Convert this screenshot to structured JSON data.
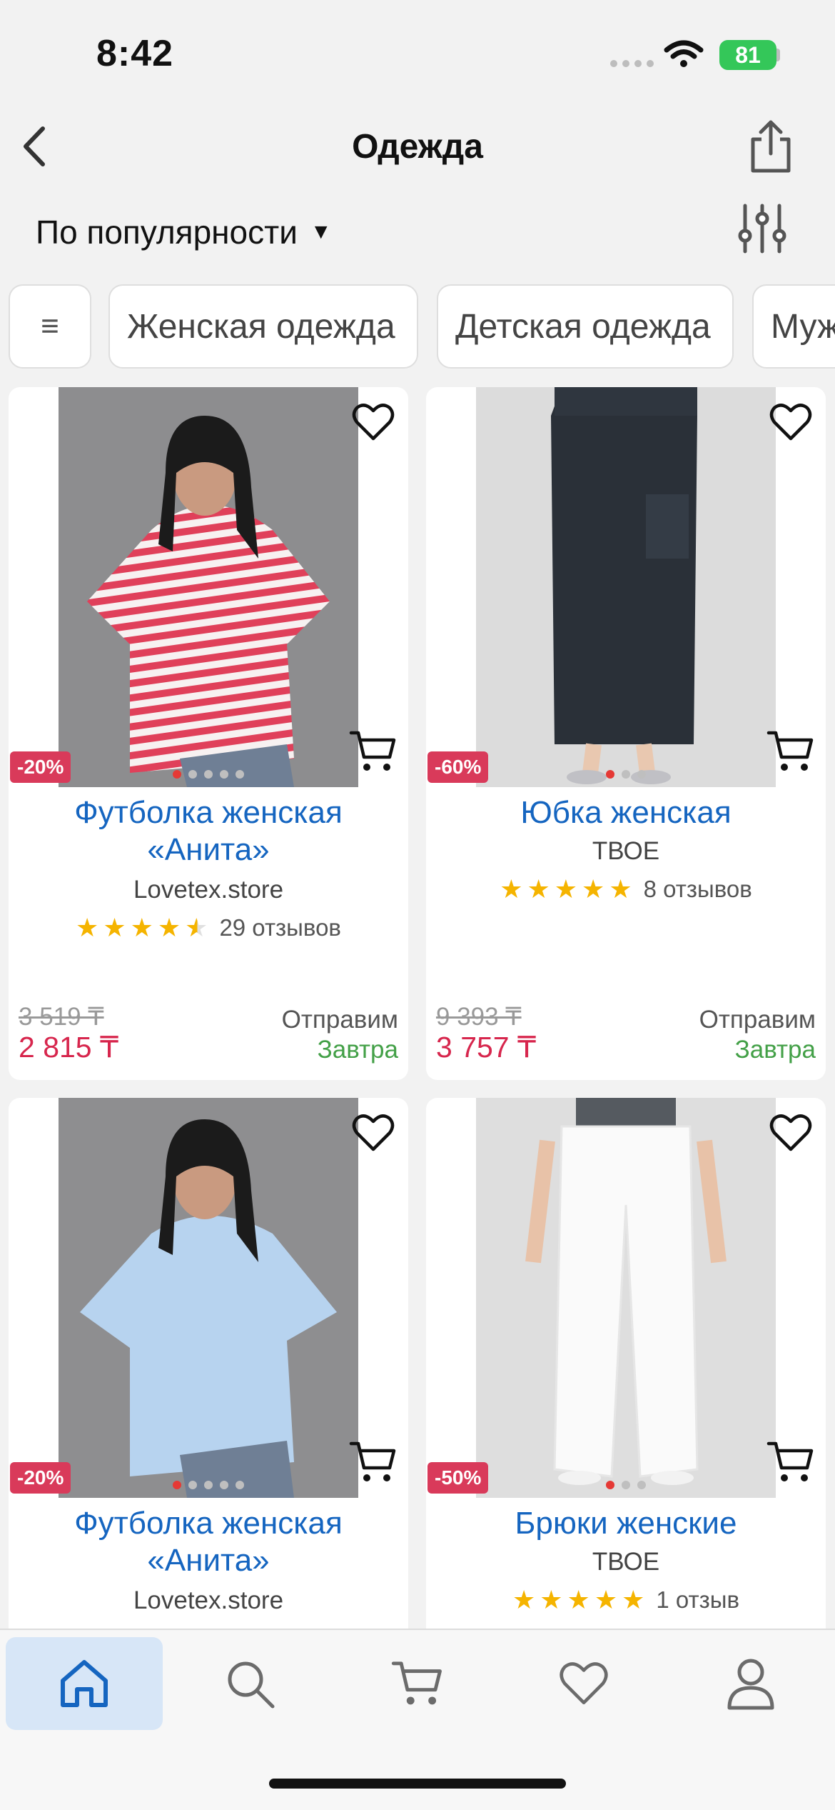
{
  "status_bar": {
    "time": "8:42",
    "battery": "81"
  },
  "header": {
    "title": "Одежда"
  },
  "sort": {
    "label": "По популярности",
    "caret": "▼"
  },
  "chips": {
    "menu_glyph": "≡",
    "items": [
      "Женская одежда",
      "Детская одежда",
      "Мужская одежда"
    ]
  },
  "products": [
    {
      "name": "Футболка женская «Анита»",
      "seller": "Lovetex.store",
      "rating": 4.5,
      "reviews": "29 отзывов",
      "discount": "-20%",
      "old_price": "3 519 ₸",
      "price": "2 815 ₸",
      "ship_label": "Отправим",
      "ship_when": "Завтра"
    },
    {
      "name": "Юбка женская",
      "seller": "ТВОЕ",
      "rating": 5,
      "reviews": "8 отзывов",
      "discount": "-60%",
      "old_price": "9 393 ₸",
      "price": "3 757 ₸",
      "ship_label": "Отправим",
      "ship_when": "Завтра"
    },
    {
      "name": "Футболка женская «Анита»",
      "seller": "Lovetex.store",
      "discount": "-20%"
    },
    {
      "name": "Брюки женские",
      "seller": "ТВОЕ",
      "rating": 5,
      "reviews": "1 отзыв",
      "discount": "-50%"
    }
  ],
  "tabs": [
    "home-icon",
    "search-icon",
    "cart-icon",
    "heart-icon",
    "profile-icon"
  ],
  "colors": {
    "accent": "#1565c0",
    "price": "#d7264d",
    "badge": "#d93a5a",
    "ship": "#43a047",
    "star": "#f5b400",
    "active_tab": "#d7e6f7"
  }
}
